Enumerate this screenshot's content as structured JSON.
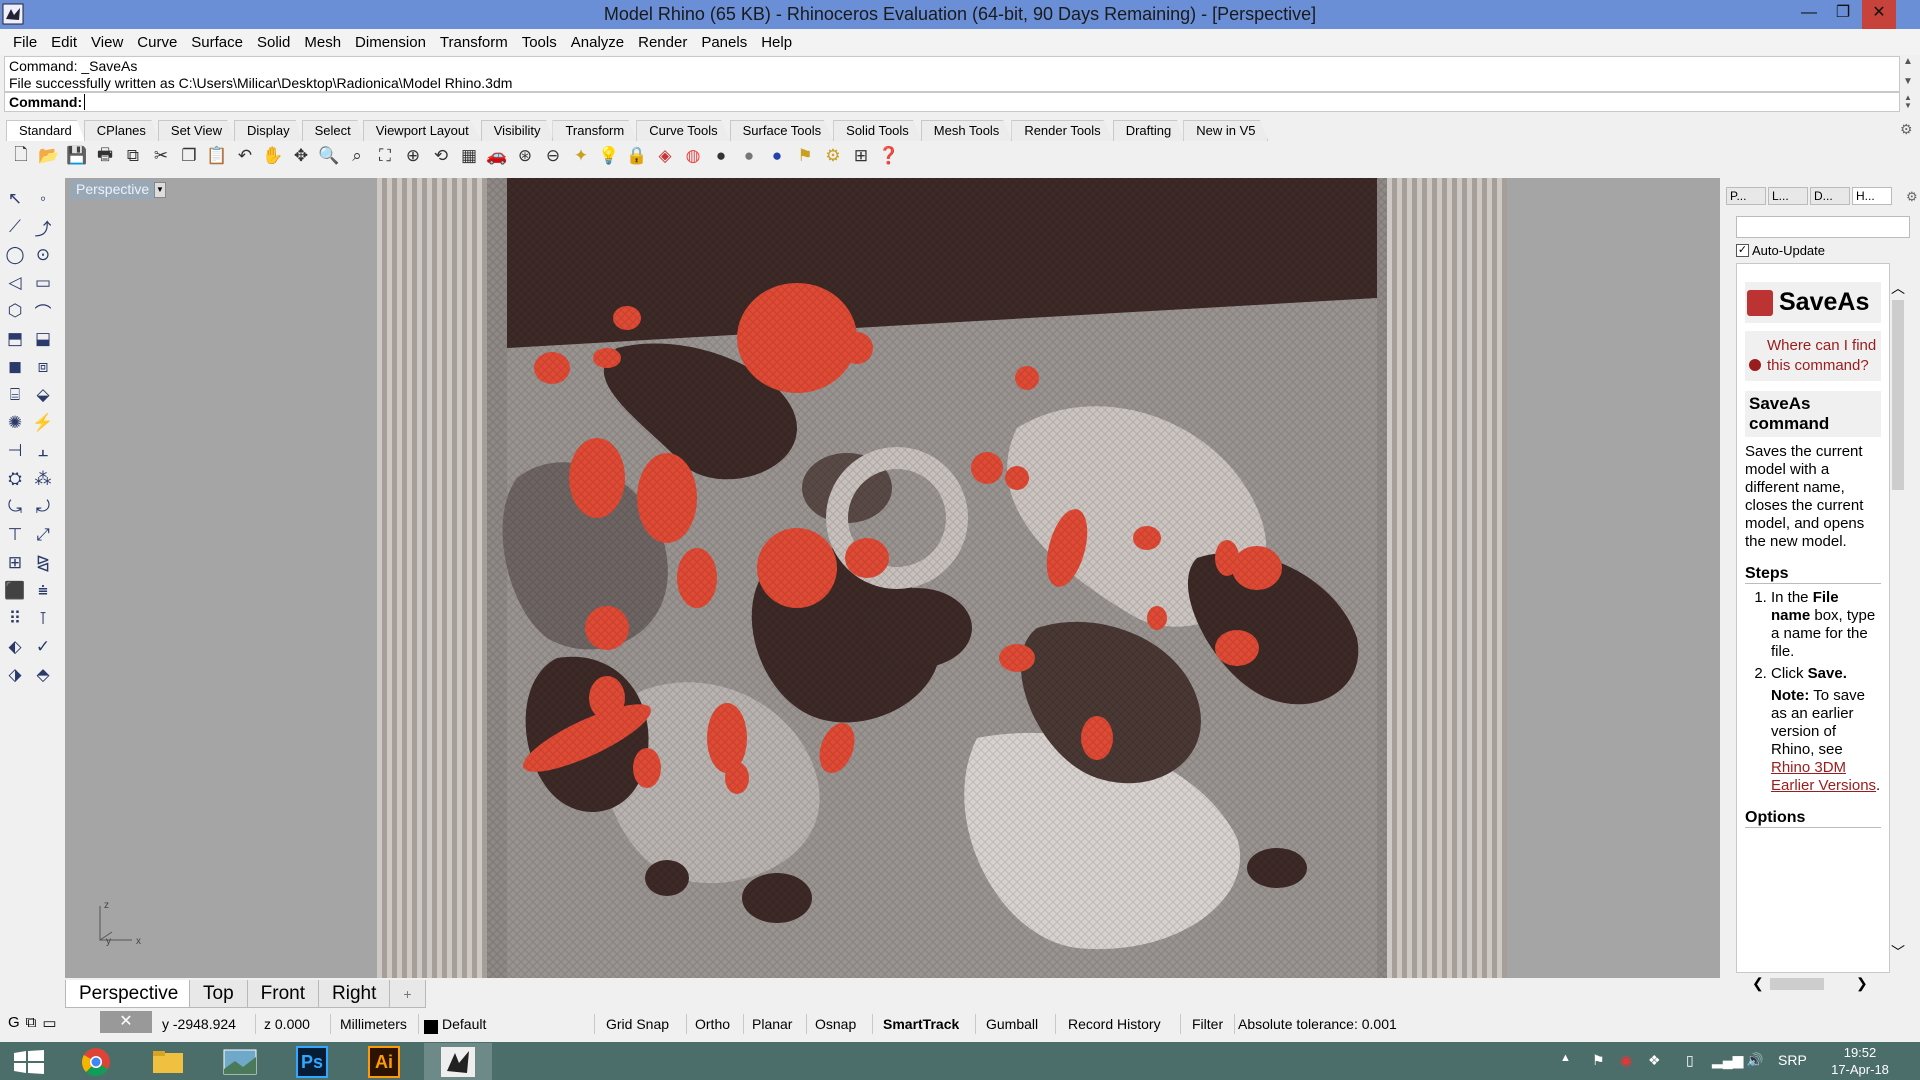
{
  "window": {
    "title": "Model Rhino (65 KB) - Rhinoceros Evaluation (64-bit, 90 Days Remaining) - [Perspective]",
    "min_glyph": "—",
    "max_glyph": "❐",
    "close_glyph": "✕"
  },
  "menu": [
    "File",
    "Edit",
    "View",
    "Curve",
    "Surface",
    "Solid",
    "Mesh",
    "Dimension",
    "Transform",
    "Tools",
    "Analyze",
    "Render",
    "Panels",
    "Help"
  ],
  "command": {
    "history_line1": "Command: _SaveAs",
    "history_line2": "File successfully written as C:\\Users\\Milicar\\Desktop\\Radionica\\Model Rhino.3dm",
    "prompt_label": "Command:",
    "prompt_value": ""
  },
  "toolbar_tabs": [
    "Standard",
    "CPlanes",
    "Set View",
    "Display",
    "Select",
    "Viewport Layout",
    "Visibility",
    "Transform",
    "Curve Tools",
    "Surface Tools",
    "Solid Tools",
    "Mesh Tools",
    "Render Tools",
    "Drafting",
    "New in V5"
  ],
  "toolbar_icons": [
    "new-icon",
    "open-icon",
    "save-icon",
    "print-icon",
    "export-icon",
    "cut-icon",
    "copy-icon",
    "paste-icon",
    "undo-icon",
    "pan-icon",
    "rotate-icon",
    "zoom-icon",
    "zoom-window-icon",
    "zoom-extents-icon",
    "zoom-selected-icon",
    "rotate-view-icon",
    "four-viewports-icon",
    "car-icon",
    "gumball-icon",
    "object-properties-icon",
    "light-icon",
    "lock-icon",
    "layer-icon",
    "render-color-icon",
    "shaded-icon",
    "rendered-icon",
    "sphere-icon",
    "materials-icon",
    "settings-icon",
    "dimension-icon",
    "help-icon"
  ],
  "viewport": {
    "label": "Perspective",
    "axis_z": "z",
    "axis_y": "y",
    "axis_x": "x"
  },
  "view_tabs": [
    "Perspective",
    "Top",
    "Front",
    "Right",
    "+"
  ],
  "right_panel": {
    "tabs": [
      "P...",
      "L...",
      "D...",
      "H..."
    ],
    "auto_update": "Auto-Update",
    "help_title": "SaveAs",
    "where_link": "Where can I find this command?",
    "cmd_heading": "SaveAs command",
    "description": "Saves the current model with a different name, closes the current model, and opens the new model.",
    "steps_heading": "Steps",
    "step1_pre": "In the ",
    "step1_bold": "File name",
    "step1_post": " box, type a name for the file.",
    "step2_pre": "Click ",
    "step2_bold": "Save.",
    "note_bold": "Note:",
    "note_text": " To save as an earlier version of Rhino, see ",
    "note_link": "Rhino 3DM Earlier Versions",
    "note_end": ".",
    "options_heading": "Options"
  },
  "status": {
    "cplane_glyph": "G",
    "y": "y -2948.924",
    "z": "z 0.000",
    "units": "Millimeters",
    "layer": "Default",
    "grid_snap": "Grid Snap",
    "ortho": "Ortho",
    "planar": "Planar",
    "osnap": "Osnap",
    "smarttrack": "SmartTrack",
    "gumball": "Gumball",
    "record_history": "Record History",
    "filter": "Filter",
    "tolerance": "Absolute tolerance: 0.001"
  },
  "taskbar": {
    "apps": [
      "chrome",
      "file-explorer",
      "photos",
      "Ps",
      "Ai",
      "rhinoceros"
    ],
    "lang": "SRP",
    "time": "19:52",
    "date": "17-Apr-18"
  },
  "colors": {
    "title_bar": "#6a8fd6",
    "viewport_bg": "#a5a5a5",
    "accent_red": "#e04a35",
    "dark_brown": "#3d2a26",
    "taskbar": "#4b6e6a"
  }
}
